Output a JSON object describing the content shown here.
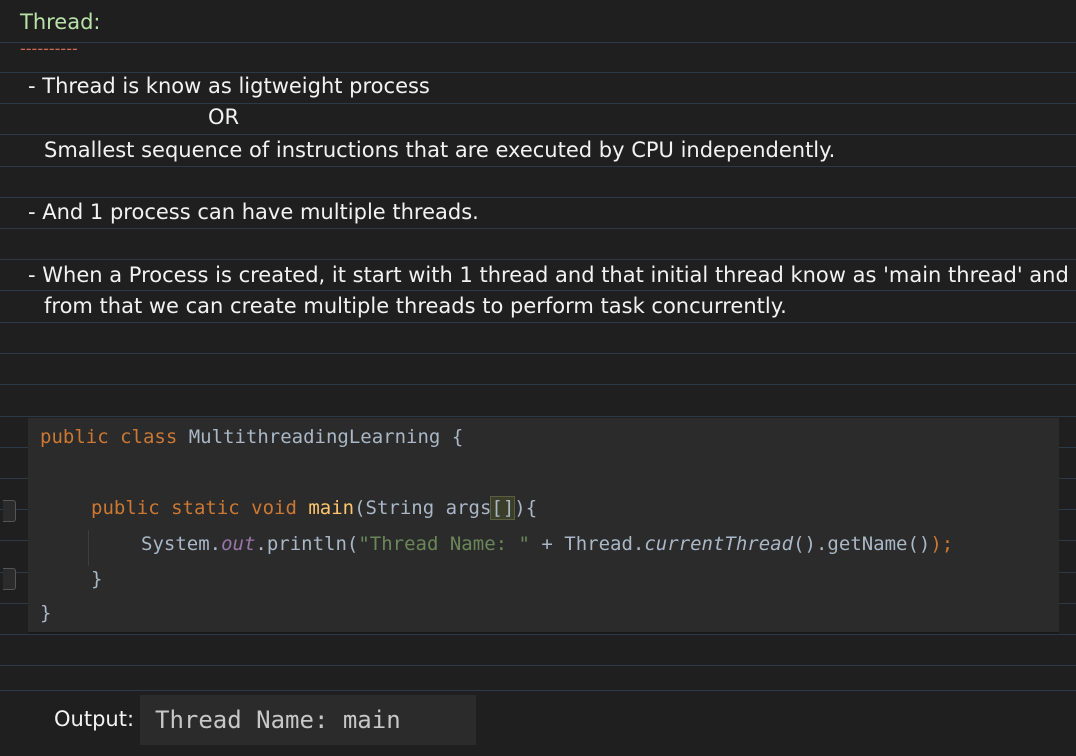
{
  "notes": {
    "heading": "Thread:",
    "underline": "----------",
    "bullet1_line1": "- Thread is know as ligtweight process",
    "bullet1_or": "OR",
    "bullet1_line2": "Smallest sequence of instructions that are executed by CPU independently.",
    "bullet2": "- And 1 process can have multiple threads.",
    "bullet3_line1": "- When a Process is created, it start with 1 thread and that initial thread know as 'main thread' and",
    "bullet3_line2": "from that we can create multiple threads to perform task concurrently."
  },
  "code": {
    "line1": {
      "kw": "public class ",
      "name": "MultithreadingLearning {"
    },
    "line2": {
      "kw": "public static void ",
      "fn": "main",
      "rest1": "(String args",
      "hl": "[]",
      "rest2": "){"
    },
    "line3": {
      "a": "System.",
      "out": "out",
      "b": ".println(",
      "str": "\"Thread Name: \"",
      "c": " + Thread.",
      "method": "currentThread",
      "d": "().getName()",
      "e": ");",
      "semi": ""
    },
    "line4": "}",
    "line5": "}"
  },
  "output": {
    "label": "Output:",
    "value": "Thread Name: main"
  },
  "colors": {
    "background": "#1f1f1f",
    "heading": "#b9e2a8",
    "code_background": "#2b2b2b",
    "keyword": "#cc7832",
    "function": "#ffc66d",
    "string": "#6a8759",
    "static_field": "#9876aa"
  }
}
